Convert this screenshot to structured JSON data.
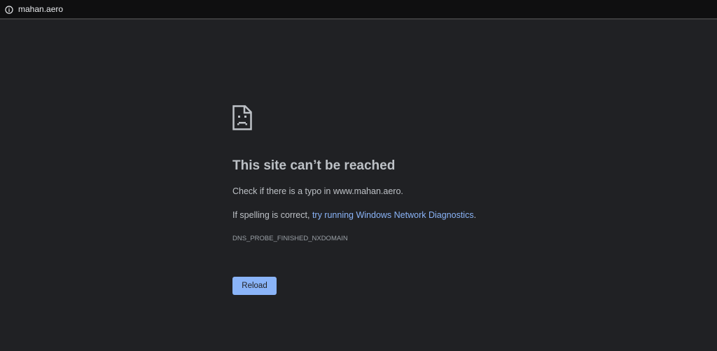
{
  "address_bar": {
    "icon": "info-icon",
    "url": "mahan.aero"
  },
  "error": {
    "icon": "sad-page-icon",
    "title": "This site can’t be reached",
    "message_line1": "Check if there is a typo in www.mahan.aero.",
    "message_line2_prefix": "If spelling is correct, ",
    "message_line2_link": "try running Windows Network Diagnostics",
    "message_line2_suffix": ".",
    "error_code": "DNS_PROBE_FINISHED_NXDOMAIN",
    "reload_label": "Reload"
  },
  "colors": {
    "background": "#202124",
    "text": "#bdc1c6",
    "link": "#8ab4f8",
    "button": "#8ab4f8"
  }
}
